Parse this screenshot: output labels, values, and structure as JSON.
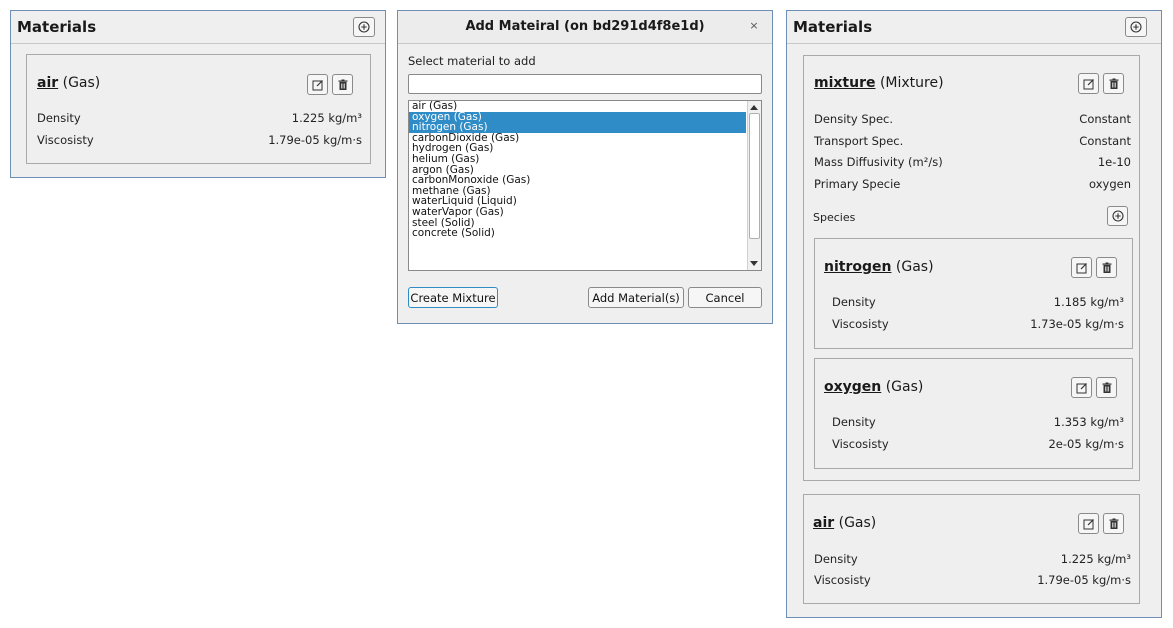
{
  "left_panel": {
    "title": "Materials",
    "card": {
      "name": "air",
      "type": "(Gas)",
      "props": [
        {
          "label": "Density",
          "value": "1.225 kg/m³"
        },
        {
          "label": "Viscosisty",
          "value": "1.79e-05 kg/m·s"
        }
      ]
    }
  },
  "dialog": {
    "title": "Add Mateiral (on bd291d4f8e1d)",
    "close": "×",
    "prompt": "Select material to add",
    "search_value": "",
    "items": [
      "air (Gas)",
      "oxygen (Gas)",
      "nitrogen (Gas)",
      "carbonDioxide (Gas)",
      "hydrogen (Gas)",
      "helium (Gas)",
      "argon (Gas)",
      "carbonMonoxide (Gas)",
      "methane (Gas)",
      "waterLiquid (Liquid)",
      "waterVapor (Gas)",
      "steel (Solid)",
      "concrete (Solid)"
    ],
    "selected": [
      "oxygen (Gas)",
      "nitrogen (Gas)"
    ],
    "buttons": {
      "create_mixture": "Create Mixture",
      "add_materials": "Add Material(s)",
      "cancel": "Cancel"
    }
  },
  "right_panel": {
    "title": "Materials",
    "mixture": {
      "name": "mixture",
      "type": "(Mixture)",
      "props": [
        {
          "label": "Density Spec.",
          "value": "Constant"
        },
        {
          "label": "Transport Spec.",
          "value": "Constant"
        },
        {
          "label": "Mass Diffusivity (m²/s)",
          "value": "1e-10"
        },
        {
          "label": "Primary Specie",
          "value": "oxygen"
        }
      ],
      "species_label": "Species",
      "species": [
        {
          "name": "nitrogen",
          "type": "(Gas)",
          "props": [
            {
              "label": "Density",
              "value": "1.185 kg/m³"
            },
            {
              "label": "Viscosisty",
              "value": "1.73e-05 kg/m·s"
            }
          ]
        },
        {
          "name": "oxygen",
          "type": "(Gas)",
          "props": [
            {
              "label": "Density",
              "value": "1.353 kg/m³"
            },
            {
              "label": "Viscosisty",
              "value": "2e-05 kg/m·s"
            }
          ]
        }
      ]
    },
    "air": {
      "name": "air",
      "type": "(Gas)",
      "props": [
        {
          "label": "Density",
          "value": "1.225 kg/m³"
        },
        {
          "label": "Viscosisty",
          "value": "1.79e-05 kg/m·s"
        }
      ]
    }
  },
  "icons": {
    "add": "plus-circle-icon",
    "edit": "edit-icon",
    "delete": "trash-icon"
  },
  "colors": {
    "selection": "#308cc6",
    "panel_border": "#6e8fb3",
    "panel_bg": "#efefef"
  }
}
